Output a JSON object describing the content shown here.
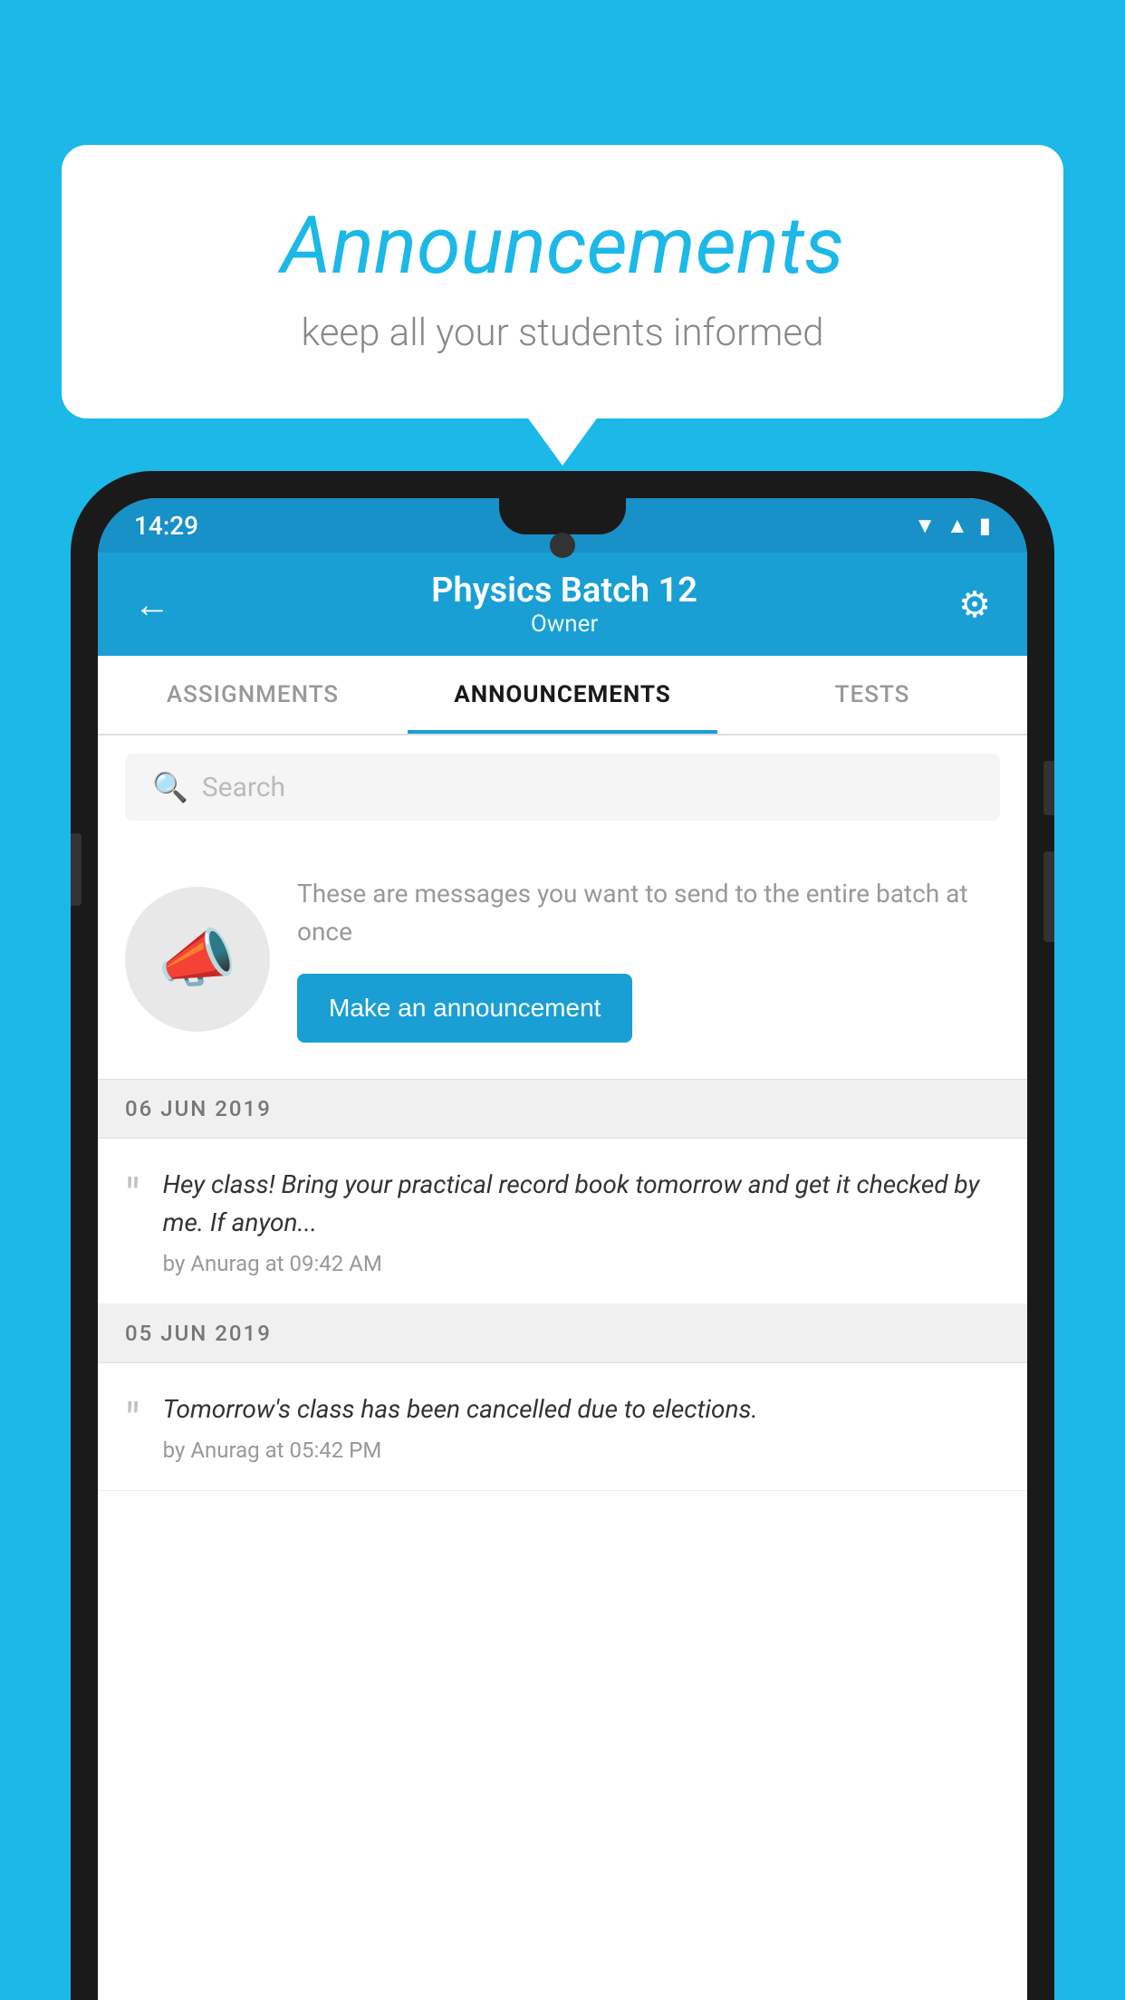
{
  "background_color": "#1bb8e8",
  "speech_bubble": {
    "title": "Announcements",
    "subtitle": "keep all your students informed"
  },
  "status_bar": {
    "time": "14:29",
    "icons": [
      "wifi",
      "signal",
      "battery"
    ]
  },
  "app_header": {
    "back_label": "←",
    "title": "Physics Batch 12",
    "subtitle": "Owner",
    "settings_label": "⚙"
  },
  "tabs": [
    {
      "label": "ASSIGNMENTS",
      "active": false
    },
    {
      "label": "ANNOUNCEMENTS",
      "active": true
    },
    {
      "label": "TESTS",
      "active": false
    },
    {
      "label": "…",
      "active": false
    }
  ],
  "search": {
    "placeholder": "Search",
    "icon": "🔍"
  },
  "empty_state": {
    "description": "These are messages you want to send to the entire batch at once",
    "button_label": "Make an announcement"
  },
  "announcements": [
    {
      "date": "06  JUN  2019",
      "text": "Hey class! Bring your practical record book tomorrow and get it checked by me. If anyon...",
      "meta": "by Anurag at 09:42 AM"
    },
    {
      "date": "05  JUN  2019",
      "text": "Tomorrow's class has been cancelled due to elections.",
      "meta": "by Anurag at 05:42 PM"
    }
  ]
}
